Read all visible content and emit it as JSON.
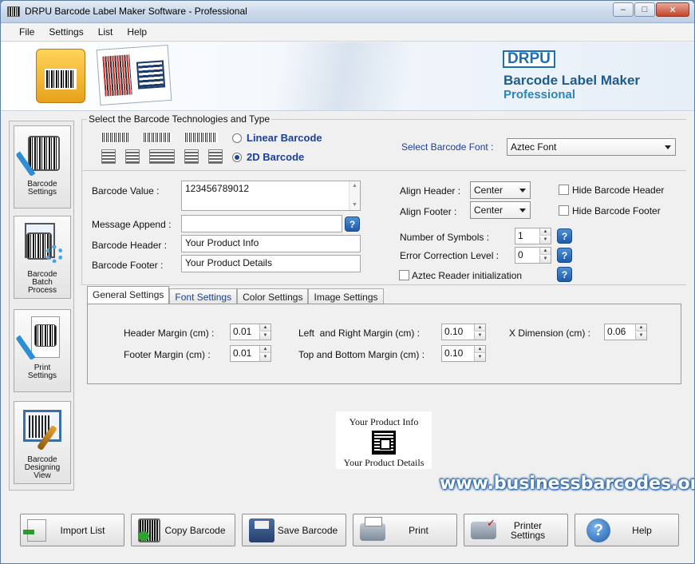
{
  "window": {
    "title": "DRPU Barcode Label Maker Software - Professional",
    "controls": {
      "minimize": "–",
      "maximize": "□",
      "close": "✕"
    }
  },
  "menu": [
    "File",
    "Settings",
    "List",
    "Help"
  ],
  "banner": {
    "logo": "DRPU",
    "product": "Barcode Label Maker",
    "edition": "Professional"
  },
  "sidebar": [
    {
      "label": "Barcode Settings",
      "icon": "barcode-settings-icon"
    },
    {
      "label": "Barcode Batch Process",
      "icon": "batch-process-icon"
    },
    {
      "label": "Print Settings",
      "icon": "print-settings-icon"
    },
    {
      "label": "Barcode Designing View",
      "icon": "designing-view-icon"
    }
  ],
  "technology": {
    "legend": "Select the Barcode Technologies and Type",
    "linear_label": "Linear Barcode",
    "twod_label": "2D Barcode",
    "selected": "2D Barcode",
    "font_label": "Select Barcode Font :",
    "font_value": "Aztec Font"
  },
  "fields": {
    "barcode_value_label": "Barcode Value :",
    "barcode_value": "123456789012",
    "message_append_label": "Message Append :",
    "message_append": "",
    "barcode_header_label": "Barcode Header :",
    "barcode_header": "Your Product Info",
    "barcode_footer_label": "Barcode Footer :",
    "barcode_footer": "Your Product Details",
    "align_header_label": "Align Header :",
    "align_header": "Center",
    "align_footer_label": "Align Footer :",
    "align_footer": "Center",
    "hide_header_label": "Hide Barcode Header",
    "hide_footer_label": "Hide Barcode Footer",
    "num_symbols_label": "Number of Symbols :",
    "num_symbols": "1",
    "error_corr_label": "Error Correction Level :",
    "error_corr": "0",
    "aztec_reader_label": "Aztec Reader initialization"
  },
  "tabs": [
    "General Settings",
    "Font Settings",
    "Color Settings",
    "Image Settings"
  ],
  "active_tab": "General Settings",
  "general": {
    "header_margin_label": "Header Margin (cm) :",
    "header_margin": "0.01",
    "footer_margin_label": "Footer Margin (cm) :",
    "footer_margin": "0.01",
    "lr_margin_label": "Left  and Right Margin (cm) :",
    "lr_margin": "0.10",
    "tb_margin_label": "Top and Bottom Margin (cm) :",
    "tb_margin": "0.10",
    "xdim_label": "X Dimension (cm) :",
    "xdim": "0.06"
  },
  "preview": {
    "header": "Your Product Info",
    "footer": "Your Product Details"
  },
  "website": "www.businessbarcodes.org",
  "bottom_buttons": [
    {
      "label": "Import List",
      "icon": "import-list-icon"
    },
    {
      "label": "Copy Barcode",
      "icon": "copy-barcode-icon"
    },
    {
      "label": "Save Barcode",
      "icon": "save-icon"
    },
    {
      "label": "Print",
      "icon": "printer-icon"
    },
    {
      "label": "Printer Settings",
      "icon": "printer-settings-icon"
    },
    {
      "label": "Help",
      "icon": "help-icon"
    }
  ],
  "help_glyph": "?"
}
